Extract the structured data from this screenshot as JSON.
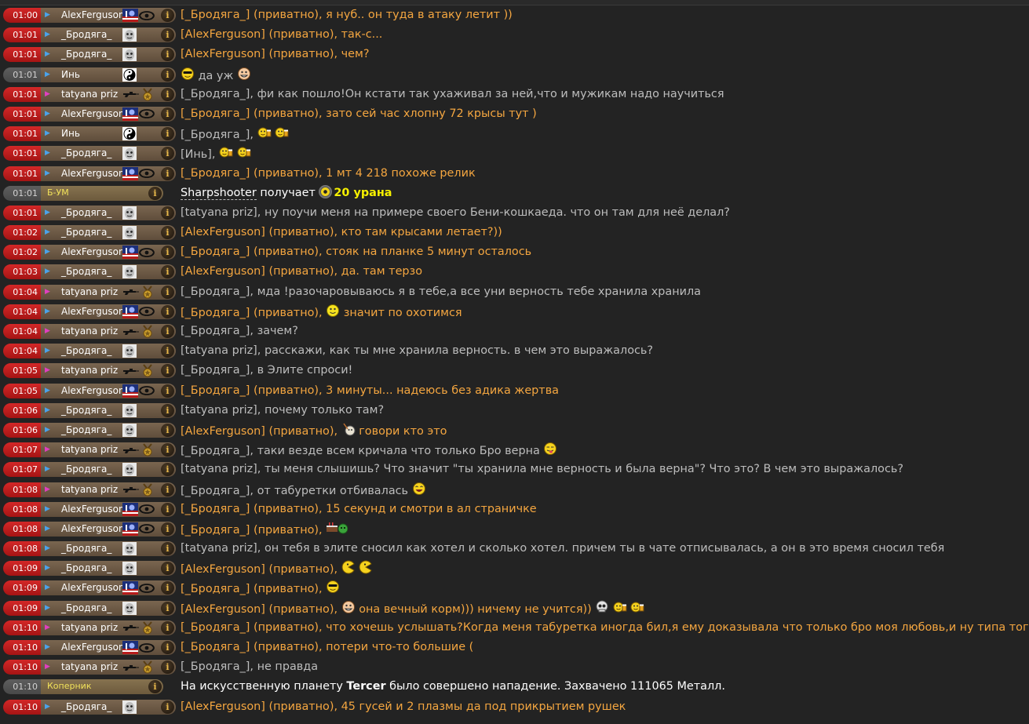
{
  "info_icon": "i",
  "colors": {
    "time_active": "#c21e1e",
    "time_inactive": "#555555",
    "nick_bg": "#6b5744",
    "private_text": "#f4a640",
    "public_text": "#bdbdbd",
    "system_text": "#ffffff",
    "system_gain": "#f6f000"
  },
  "rows": [
    {
      "time": "01:00",
      "nick": "AlexFerguson",
      "gender": "m",
      "icons": [
        "flag-avatar-icon",
        "eye-badge-icon"
      ],
      "to": "[_Бродяга_]",
      "priv": " (приватно)",
      "text": ", я нуб.. он туда в атаку летит ))",
      "emotes": []
    },
    {
      "time": "01:01",
      "nick": "_Бродяга_",
      "gender": "m",
      "icons": [
        "face-avatar-icon"
      ],
      "to": "[AlexFerguson]",
      "priv": " (приватно)",
      "text": ", так-с...",
      "emotes": []
    },
    {
      "time": "01:01",
      "nick": "_Бродяга_",
      "gender": "m",
      "icons": [
        "face-avatar-icon"
      ],
      "to": "[AlexFerguson]",
      "priv": " (приватно)",
      "text": ", чем?",
      "emotes": []
    },
    {
      "time": "01:01",
      "nick": "Инь",
      "gender": "m",
      "dim": true,
      "icons": [
        "yin-yang-icon"
      ],
      "lead_emotes": [
        "cool-smiley-icon"
      ],
      "to": "",
      "priv": "",
      "text": " да уж ",
      "emotes": [
        "grin-smiley-icon"
      ]
    },
    {
      "time": "01:01",
      "nick": "tatyana priz",
      "gender": "f",
      "icons": [
        "rifle-icon",
        "medal-icon"
      ],
      "to": "[_Бродяга_]",
      "priv": "",
      "text": ", фи как пошло!Он кстати так ухаживал за ней,что и мужикам надо научиться",
      "emotes": []
    },
    {
      "time": "01:01",
      "nick": "AlexFerguson",
      "gender": "m",
      "icons": [
        "flag-avatar-icon",
        "eye-badge-icon"
      ],
      "to": "[_Бродяга_]",
      "priv": " (приватно)",
      "text": ", зато сей час хлопну 72 крысы тут )",
      "emotes": []
    },
    {
      "time": "01:01",
      "nick": "Инь",
      "gender": "m",
      "icons": [
        "yin-yang-icon"
      ],
      "to": "[_Бродяга_]",
      "priv": "",
      "text": ", ",
      "emotes": [
        "beer-smiley-icon",
        "beer-smiley-icon"
      ]
    },
    {
      "time": "01:01",
      "nick": "_Бродяга_",
      "gender": "m",
      "icons": [
        "face-avatar-icon"
      ],
      "to": "[Инь]",
      "priv": "",
      "text": ", ",
      "emotes": [
        "beer-smiley-icon",
        "beer-smiley-icon"
      ]
    },
    {
      "time": "01:01",
      "nick": "AlexFerguson",
      "gender": "m",
      "icons": [
        "flag-avatar-icon",
        "eye-badge-icon"
      ],
      "to": "[_Бродяга_]",
      "priv": " (приватно)",
      "text": ", 1 мт 4 218 похоже релик",
      "emotes": []
    },
    {
      "time": "01:01",
      "nick": "Б-УМ",
      "system": "gain",
      "dim": true,
      "target": "Sharpshooter",
      "action": " получает ",
      "amount": "20 урана"
    },
    {
      "time": "01:01",
      "nick": "_Бродяга_",
      "gender": "m",
      "icons": [
        "face-avatar-icon"
      ],
      "to": "[tatyana priz]",
      "priv": "",
      "text": ", ну поучи меня на примере своего Бени-кошкаеда. что он там для неё делал?",
      "emotes": []
    },
    {
      "time": "01:02",
      "nick": "_Бродяга_",
      "gender": "m",
      "icons": [
        "face-avatar-icon"
      ],
      "to": "[AlexFerguson]",
      "priv": " (приватно)",
      "text": ", кто там крысами летает?))",
      "emotes": []
    },
    {
      "time": "01:02",
      "nick": "AlexFerguson",
      "gender": "m",
      "icons": [
        "flag-avatar-icon",
        "eye-badge-icon"
      ],
      "to": "[_Бродяга_]",
      "priv": " (приватно)",
      "text": ", стояк на планке 5 минут осталось",
      "emotes": []
    },
    {
      "time": "01:03",
      "nick": "_Бродяга_",
      "gender": "m",
      "icons": [
        "face-avatar-icon"
      ],
      "to": "[AlexFerguson]",
      "priv": " (приватно)",
      "text": ", да. там терзо",
      "emotes": []
    },
    {
      "time": "01:04",
      "nick": "tatyana priz",
      "gender": "f",
      "icons": [
        "rifle-icon",
        "medal-icon"
      ],
      "to": "[_Бродяга_]",
      "priv": "",
      "text": ", мда !разочаровываюсь я в тебе,а все уни верность тебе хранила хранила",
      "emotes": []
    },
    {
      "time": "01:04",
      "nick": "AlexFerguson",
      "gender": "m",
      "icons": [
        "flag-avatar-icon",
        "eye-badge-icon"
      ],
      "to": "[_Бродяга_]",
      "priv": " (приватно)",
      "text": ", ",
      "emotes": [
        "smile-smiley-icon"
      ],
      "tail": " значит по охотимся"
    },
    {
      "time": "01:04",
      "nick": "tatyana priz",
      "gender": "f",
      "icons": [
        "rifle-icon",
        "medal-icon"
      ],
      "to": "[_Бродяга_]",
      "priv": "",
      "text": ", зачем?",
      "emotes": []
    },
    {
      "time": "01:04",
      "nick": "_Бродяга_",
      "gender": "m",
      "icons": [
        "face-avatar-icon"
      ],
      "to": "[tatyana priz]",
      "priv": "",
      "text": ", расскажи, как ты мне хранила верность. в чем это выражалось?",
      "emotes": []
    },
    {
      "time": "01:05",
      "nick": "tatyana priz",
      "gender": "f",
      "icons": [
        "rifle-icon",
        "medal-icon"
      ],
      "to": "[_Бродяга_]",
      "priv": "",
      "text": ", в Элите спроси!",
      "emotes": []
    },
    {
      "time": "01:05",
      "nick": "AlexFerguson",
      "gender": "m",
      "icons": [
        "flag-avatar-icon",
        "eye-badge-icon"
      ],
      "to": "[_Бродяга_]",
      "priv": " (приватно)",
      "text": ", 3 минуты... надеюсь без адика жертва",
      "emotes": []
    },
    {
      "time": "01:06",
      "nick": "_Бродяга_",
      "gender": "m",
      "icons": [
        "face-avatar-icon"
      ],
      "to": "[tatyana priz]",
      "priv": "",
      "text": ", почему только там?",
      "emotes": []
    },
    {
      "time": "01:06",
      "nick": "_Бродяга_",
      "gender": "m",
      "icons": [
        "face-avatar-icon"
      ],
      "to": "[AlexFerguson]",
      "priv": " (приватно)",
      "text": ", ",
      "emotes": [
        "smoke-smiley-icon"
      ],
      "tail": " говори кто это"
    },
    {
      "time": "01:07",
      "nick": "tatyana priz",
      "gender": "f",
      "icons": [
        "rifle-icon",
        "medal-icon"
      ],
      "to": "[_Бродяга_]",
      "priv": "",
      "text": ", таки везде всем кричала что только Бро верна ",
      "emotes": [
        "tongue-smiley-icon"
      ]
    },
    {
      "time": "01:07",
      "nick": "_Бродяга_",
      "gender": "m",
      "icons": [
        "face-avatar-icon"
      ],
      "to": "[tatyana priz]",
      "priv": "",
      "text": ", ты меня слышишь? Что значит \"ты хранила мне верность и была верна\"? Что это? В чем это выражалось?",
      "emotes": []
    },
    {
      "time": "01:08",
      "nick": "tatyana priz",
      "gender": "f",
      "icons": [
        "rifle-icon",
        "medal-icon"
      ],
      "to": "[_Бродяга_]",
      "priv": "",
      "text": ", от табуретки отбивалась ",
      "emotes": [
        "laugh-smiley-icon"
      ]
    },
    {
      "time": "01:08",
      "nick": "AlexFerguson",
      "gender": "m",
      "icons": [
        "flag-avatar-icon",
        "eye-badge-icon"
      ],
      "to": "[_Бродяга_]",
      "priv": " (приватно)",
      "text": ", 15 секунд и смотри в ал страничке",
      "emotes": []
    },
    {
      "time": "01:08",
      "nick": "AlexFerguson",
      "gender": "m",
      "icons": [
        "flag-avatar-icon",
        "eye-badge-icon"
      ],
      "to": "[_Бродяга_]",
      "priv": " (приватно)",
      "text": ", ",
      "emotes": [
        "cake-smiley-icon"
      ]
    },
    {
      "time": "01:08",
      "nick": "_Бродяга_",
      "gender": "m",
      "icons": [
        "face-avatar-icon"
      ],
      "to": "[tatyana priz]",
      "priv": "",
      "text": ", он тебя в элите сносил как хотел и сколько хотел. причем ты в чате отписывалась, а он в это время сносил тебя",
      "emotes": []
    },
    {
      "time": "01:09",
      "nick": "_Бродяга_",
      "gender": "m",
      "icons": [
        "face-avatar-icon"
      ],
      "to": "[AlexFerguson]",
      "priv": " (приватно)",
      "text": ", ",
      "emotes": [
        "pacman-smiley-icon",
        "pacman-smiley-icon"
      ]
    },
    {
      "time": "01:09",
      "nick": "AlexFerguson",
      "gender": "m",
      "icons": [
        "flag-avatar-icon",
        "eye-badge-icon"
      ],
      "to": "[_Бродяга_]",
      "priv": " (приватно)",
      "text": ", ",
      "emotes": [
        "cool-smiley-icon"
      ]
    },
    {
      "time": "01:09",
      "nick": "_Бродяга_",
      "gender": "m",
      "icons": [
        "face-avatar-icon"
      ],
      "to": "[AlexFerguson]",
      "priv": " (приватно)",
      "text": ", ",
      "emotes": [
        "grin-smiley-icon"
      ],
      "tail": " она вечный корм))) ничему не учится)) ",
      "tail_emotes": [
        "skull-smiley-icon",
        "beer-smiley-icon",
        "beer-smiley-icon"
      ]
    },
    {
      "time": "01:10",
      "nick": "tatyana priz",
      "gender": "f",
      "icons": [
        "rifle-icon",
        "medal-icon"
      ],
      "to": "[_Бродяга_]",
      "priv": " (приватно)",
      "text": ", что хочешь услышать?Когда меня табуретка иногда бил,я ему доказывала что только бро моя любовь,и ну типа того",
      "emotes": []
    },
    {
      "time": "01:10",
      "nick": "AlexFerguson",
      "gender": "m",
      "icons": [
        "flag-avatar-icon",
        "eye-badge-icon"
      ],
      "to": "[_Бродяга_]",
      "priv": " (приватно)",
      "text": ", потери что-то большие (",
      "emotes": []
    },
    {
      "time": "01:10",
      "nick": "tatyana priz",
      "gender": "f",
      "icons": [
        "rifle-icon",
        "medal-icon"
      ],
      "to": "[_Бродяга_]",
      "priv": "",
      "text": ", не правда",
      "emotes": []
    },
    {
      "time": "01:10",
      "nick": "Коперник",
      "system": "attack",
      "dim": true,
      "pre": "На искусственную планету ",
      "planet": "Tercer",
      "post": " было совершено нападение. Захвачено 111065 Металл."
    },
    {
      "time": "01:10",
      "nick": "_Бродяга_",
      "gender": "m",
      "icons": [
        "face-avatar-icon"
      ],
      "to": "[AlexFerguson]",
      "priv": " (приватно)",
      "text": ", 45 гусей и 2 плазмы да под прикрытием рушек",
      "emotes": []
    }
  ]
}
